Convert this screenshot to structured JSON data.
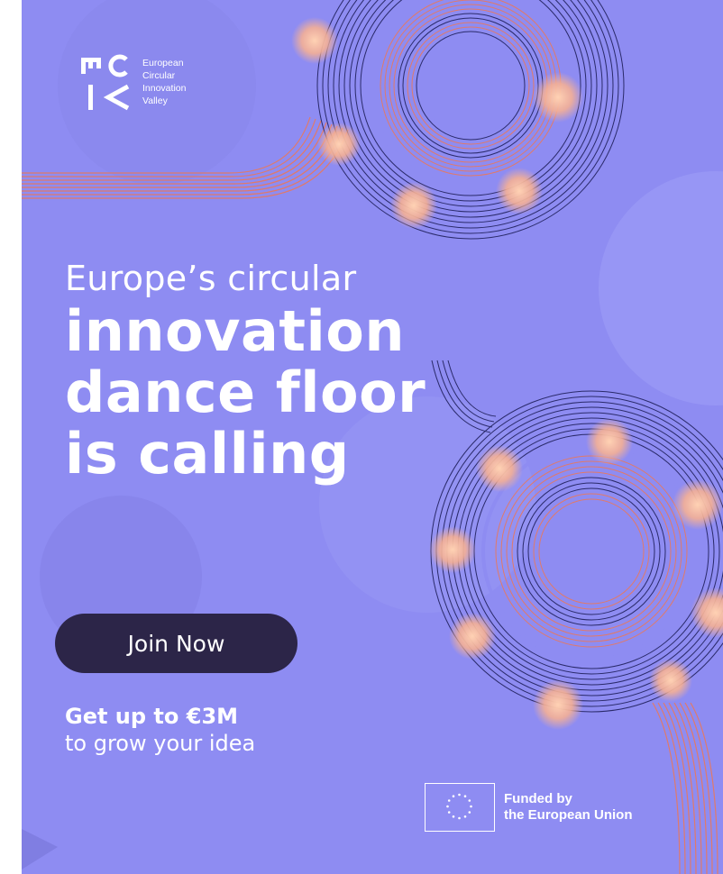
{
  "logo": {
    "lines": [
      "European",
      "Circular",
      "Innovation",
      "Valley"
    ]
  },
  "headline": {
    "intro": "Europe’s circular",
    "line1": "innovation",
    "line2": "dance floor",
    "line3": "is calling"
  },
  "cta": {
    "label": "Join Now"
  },
  "offer": {
    "strong": "Get up to €3M",
    "rest": "to grow your idea"
  },
  "eu": {
    "line1": "Funded by",
    "line2": "the European Union"
  },
  "colors": {
    "background": "#8e8cf2",
    "button": "#2c2548",
    "ring_dark": "#2a2a6a",
    "ring_accent": "#e07a6a",
    "bulb": "#f5b89a"
  }
}
